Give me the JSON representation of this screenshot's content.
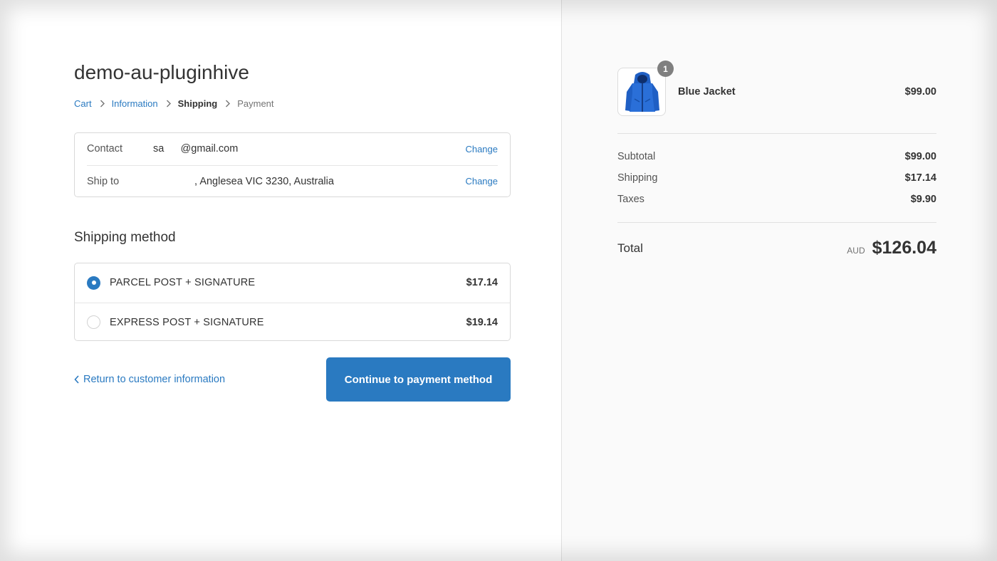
{
  "shop": {
    "title": "demo-au-pluginhive"
  },
  "breadcrumb": {
    "cart": "Cart",
    "information": "Information",
    "shipping": "Shipping",
    "payment": "Payment"
  },
  "review": {
    "contact_label": "Contact",
    "contact_value": "sa        @gmail.com",
    "ship_label": "Ship to",
    "ship_value": "                    , Anglesea VIC 3230, Australia",
    "change_label": "Change"
  },
  "shipping_method": {
    "title": "Shipping method",
    "options": [
      {
        "name": "PARCEL POST + SIGNATURE",
        "price": "$17.14",
        "selected": true
      },
      {
        "name": "EXPRESS POST + SIGNATURE",
        "price": "$19.14",
        "selected": false
      }
    ]
  },
  "actions": {
    "return_label": "Return to customer information",
    "continue_label": "Continue to payment method"
  },
  "order": {
    "item": {
      "name": "Blue Jacket",
      "price": "$99.00",
      "quantity": "1"
    },
    "subtotal_label": "Subtotal",
    "subtotal_value": "$99.00",
    "shipping_label": "Shipping",
    "shipping_value": "$17.14",
    "taxes_label": "Taxes",
    "taxes_value": "$9.90",
    "total_label": "Total",
    "currency": "AUD",
    "total_value": "$126.04"
  },
  "colors": {
    "accent": "#2a7ac1",
    "sidebar_bg": "#fafafa",
    "text": "#333333"
  },
  "icons": [
    "chevron-right-icon",
    "chevron-left-icon",
    "radio-selected-icon",
    "radio-unselected-icon",
    "jacket-product-image"
  ]
}
